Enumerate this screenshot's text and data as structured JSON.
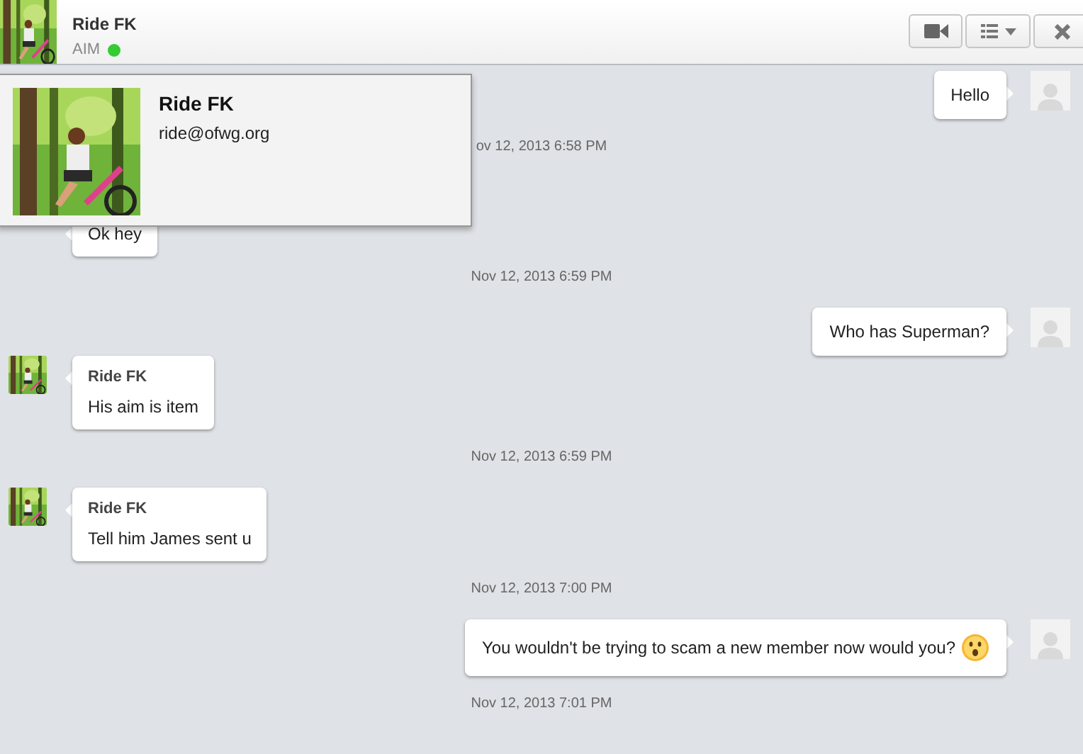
{
  "header": {
    "name": "Ride FK",
    "service": "AIM",
    "online": true
  },
  "toolbar": [
    {
      "kind": "video"
    },
    {
      "kind": "menu"
    },
    {
      "kind": "close"
    }
  ],
  "popover": {
    "name": "Ride FK",
    "email": "ride@ofwg.org"
  },
  "messages": [
    {
      "kind": "outgoing",
      "text": "Hello"
    },
    {
      "kind": "timestamp",
      "text": "ov 12, 2013 6:58 PM"
    },
    {
      "kind": "incoming",
      "text": "Ok hey"
    },
    {
      "kind": "timestamp",
      "text": "Nov 12, 2013 6:59 PM"
    },
    {
      "kind": "outgoing",
      "text": "Who has Superman?"
    },
    {
      "kind": "incoming",
      "sender": "Ride FK",
      "text": "His aim is item"
    },
    {
      "kind": "timestamp",
      "text": "Nov 12, 2013 6:59 PM"
    },
    {
      "kind": "incoming",
      "sender": "Ride FK",
      "text": "Tell him James sent u"
    },
    {
      "kind": "timestamp",
      "text": "Nov 12, 2013 7:00 PM"
    },
    {
      "kind": "outgoing",
      "text": "You wouldn't be trying to scam a new member now would you?",
      "emoji": true
    },
    {
      "kind": "timestamp",
      "text": "Nov 12, 2013 7:01 PM"
    }
  ]
}
